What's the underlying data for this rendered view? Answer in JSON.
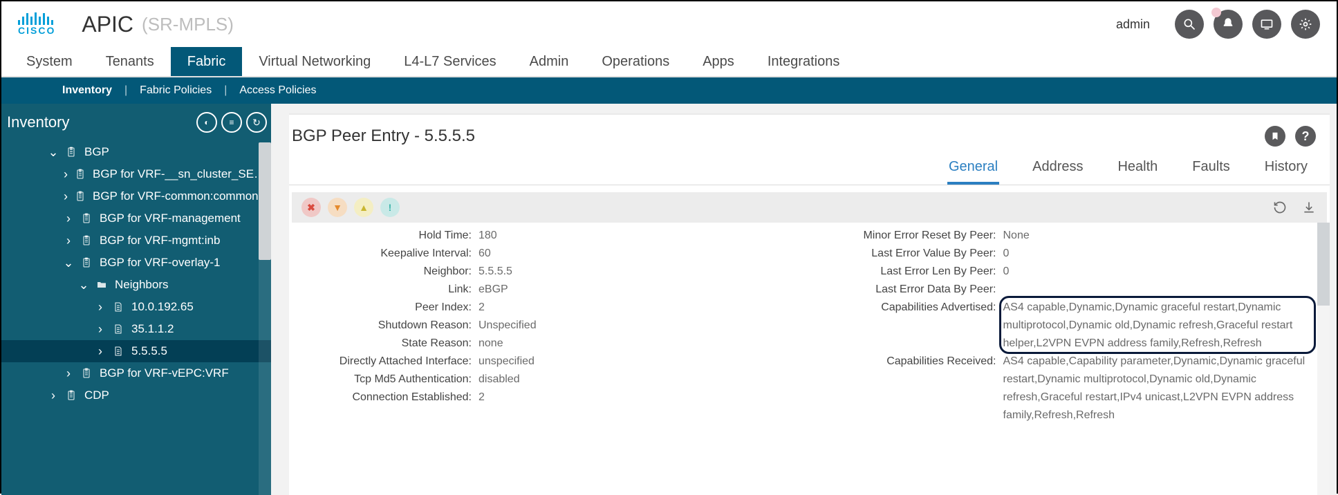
{
  "header": {
    "brand": "cisco",
    "app_title": "APIC",
    "app_sub": "(SR-MPLS)",
    "user": "admin",
    "icons": [
      "search",
      "bell",
      "monitor",
      "gear"
    ]
  },
  "mainnav": {
    "items": [
      "System",
      "Tenants",
      "Fabric",
      "Virtual Networking",
      "L4-L7 Services",
      "Admin",
      "Operations",
      "Apps",
      "Integrations"
    ],
    "active_index": 2
  },
  "subnav": {
    "items": [
      "Inventory",
      "Fabric Policies",
      "Access Policies"
    ],
    "active_index": 0
  },
  "sidebar": {
    "title": "Inventory",
    "tree": [
      {
        "name": "BGP",
        "icon": "clip",
        "chev": "down",
        "pad": 1
      },
      {
        "name": "BGP for VRF-__sn_cluster_SE…",
        "icon": "clip",
        "chev": "right",
        "pad": 2
      },
      {
        "name": "BGP for VRF-common:common",
        "icon": "clip",
        "chev": "right",
        "pad": 2
      },
      {
        "name": "BGP for VRF-management",
        "icon": "clip",
        "chev": "right",
        "pad": 2
      },
      {
        "name": "BGP for VRF-mgmt:inb",
        "icon": "clip",
        "chev": "right",
        "pad": 2
      },
      {
        "name": "BGP for VRF-overlay-1",
        "icon": "clip",
        "chev": "down",
        "pad": 2
      },
      {
        "name": "Neighbors",
        "icon": "folder",
        "chev": "down",
        "pad": 3
      },
      {
        "name": "10.0.192.65",
        "icon": "doc",
        "chev": "right",
        "pad": 4
      },
      {
        "name": "35.1.1.2",
        "icon": "doc",
        "chev": "right",
        "pad": 4
      },
      {
        "name": "5.5.5.5",
        "icon": "doc",
        "chev": "right",
        "pad": 4,
        "selected": true
      },
      {
        "name": "BGP for VRF-vEPC:VRF",
        "icon": "clip",
        "chev": "right",
        "pad": 2
      },
      {
        "name": "CDP",
        "icon": "clip",
        "chev": "right",
        "pad": 1
      }
    ]
  },
  "pane": {
    "title": "BGP Peer Entry - 5.5.5.5",
    "tabs": [
      "General",
      "Address",
      "Health",
      "Faults",
      "History"
    ],
    "active_tab": 0,
    "left_fields": [
      {
        "k": "Hold Time:",
        "v": "180"
      },
      {
        "k": "Keepalive Interval:",
        "v": "60"
      },
      {
        "k": "Neighbor:",
        "v": "5.5.5.5"
      },
      {
        "k": "Link:",
        "v": "eBGP"
      },
      {
        "k": "Peer Index:",
        "v": "2"
      },
      {
        "k": "Shutdown Reason:",
        "v": "Unspecified"
      },
      {
        "k": "State Reason:",
        "v": "none"
      },
      {
        "k": "Directly Attached Interface:",
        "v": "unspecified"
      },
      {
        "k": "Tcp Md5 Authentication:",
        "v": "disabled"
      },
      {
        "k": "Connection Established:",
        "v": "2"
      }
    ],
    "right_fields": [
      {
        "k": "Minor Error Reset By Peer:",
        "v": "None"
      },
      {
        "k": "Last Error Value By Peer:",
        "v": "0"
      },
      {
        "k": "Last Error Len By Peer:",
        "v": "0"
      },
      {
        "k": "Last Error Data By Peer:",
        "v": ""
      },
      {
        "k": "Capabilities Advertised:",
        "v": "AS4 capable,Dynamic,Dynamic graceful restart,Dynamic multiprotocol,Dynamic old,Dynamic refresh,Graceful restart helper,L2VPN EVPN address family,Refresh,Refresh"
      },
      {
        "k": "Capabilities Received:",
        "v": "AS4 capable,Capability parameter,Dynamic,Dynamic graceful restart,Dynamic multiprotocol,Dynamic old,Dynamic refresh,Graceful restart,IPv4 unicast,L2VPN EVPN address family,Refresh,Refresh"
      }
    ]
  }
}
